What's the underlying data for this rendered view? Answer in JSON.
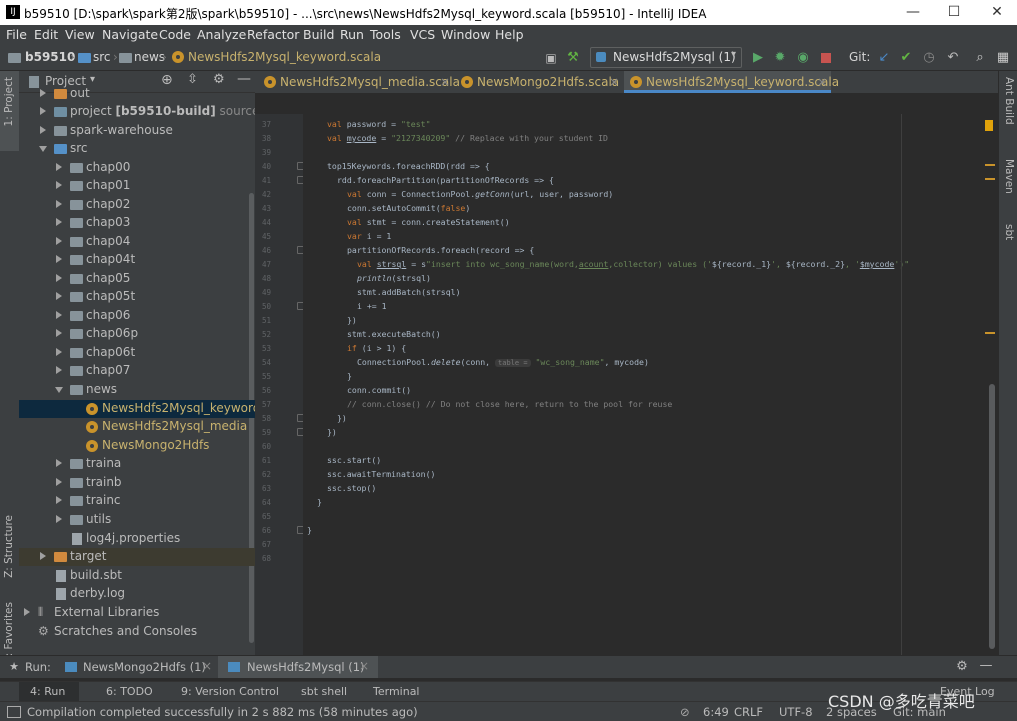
{
  "window": {
    "title": "b59510 [D:\\spark\\spark第2版\\spark\\b59510] - ...\\src\\news\\NewsHdfs2Mysql_keyword.scala [b59510] - IntelliJ IDEA",
    "minimize": "—",
    "maximize": "☐",
    "close": "✕"
  },
  "menu": [
    "File",
    "Edit",
    "View",
    "Navigate",
    "Code",
    "Analyze",
    "Refactor",
    "Build",
    "Run",
    "Tools",
    "VCS",
    "Window",
    "Help"
  ],
  "breadcrumb": [
    "b59510",
    "src",
    "news",
    "NewsHdfs2Mysql_keyword.scala"
  ],
  "toolbar": {
    "run_config": "NewsHdfs2Mysql (1)",
    "git_label": "Git:"
  },
  "left_tabs": {
    "project": "1: Project",
    "structure": "Z: Structure",
    "favorites": "2: Favorites"
  },
  "right_tabs": {
    "ant": "Ant Build",
    "maven": "Maven",
    "sbt": "sbt"
  },
  "project_pane": {
    "title": "Project",
    "items": [
      {
        "label": "out",
        "bold": "",
        "suffix": ""
      },
      {
        "label": "project ",
        "bold": "[b59510-build]",
        "suffix": " sources roo"
      },
      {
        "label": "spark-warehouse",
        "bold": "",
        "suffix": ""
      },
      {
        "label": "src",
        "bold": "",
        "suffix": ""
      },
      {
        "label": "chap00"
      },
      {
        "label": "chap01"
      },
      {
        "label": "chap02"
      },
      {
        "label": "chap03"
      },
      {
        "label": "chap04"
      },
      {
        "label": "chap04t"
      },
      {
        "label": "chap05"
      },
      {
        "label": "chap05t"
      },
      {
        "label": "chap06"
      },
      {
        "label": "chap06p"
      },
      {
        "label": "chap06t"
      },
      {
        "label": "chap07"
      },
      {
        "label": "news"
      },
      {
        "label": "NewsHdfs2Mysql_keyword"
      },
      {
        "label": "NewsHdfs2Mysql_media"
      },
      {
        "label": "NewsMongo2Hdfs"
      },
      {
        "label": "traina"
      },
      {
        "label": "trainb"
      },
      {
        "label": "trainc"
      },
      {
        "label": "utils"
      },
      {
        "label": "log4j.properties"
      },
      {
        "label": "target"
      },
      {
        "label": "build.sbt"
      },
      {
        "label": "derby.log"
      },
      {
        "label": "External Libraries"
      },
      {
        "label": "Scratches and Consoles"
      }
    ]
  },
  "editor_tabs": [
    "NewsHdfs2Mysql_media.scala",
    "NewsMongo2Hdfs.scala",
    "NewsHdfs2Mysql_keyword.scala"
  ],
  "line_numbers": [
    "37",
    "38",
    "39",
    "40",
    "41",
    "42",
    "43",
    "44",
    "45",
    "46",
    "47",
    "48",
    "49",
    "50",
    "51",
    "52",
    "53",
    "54",
    "55",
    "56",
    "57",
    "58",
    "59",
    "60",
    "61",
    "62",
    "63",
    "64",
    "65",
    "66",
    "67",
    "68"
  ],
  "code": {
    "l37": {
      "kw": "val ",
      "a": "password = ",
      "s": "\"test\""
    },
    "l38": {
      "kw": "val ",
      "a": "mycode",
      "b": " = ",
      "s": "\"2127340209\"",
      "c": " // Replace with your student ID"
    },
    "l40": "top15Keywords.foreachRDD(rdd => {",
    "l41": "rdd.foreachPartition(partitionOfRecords => {",
    "l42": {
      "kw": "val ",
      "a": "conn = ConnectionPool.",
      "f": "getConn",
      "b": "(url, user, password)"
    },
    "l43": {
      "a": "conn.setAutoCommit(",
      "kw": "false",
      "b": ")"
    },
    "l44": {
      "kw": "val ",
      "a": "stmt = conn.createStatement()"
    },
    "l45": {
      "kw": "var ",
      "a": "i = 1"
    },
    "l46": "partitionOfRecords.foreach(record => {",
    "l47": {
      "kw": "val ",
      "v": "strsql",
      "a": " = s",
      "s1": "\"insert into wc_song_name(word,",
      "u": "acount",
      "s2": ",collector) values ('",
      "i1": "${record._1}",
      "s3": "', ",
      "i2": "${record._2}",
      "s4": ", '",
      "i3": "$mycode",
      "s5": "')\""
    },
    "l48": {
      "f": "println",
      "a": "(strsql)"
    },
    "l49": "stmt.addBatch(strsql)",
    "l50": "i += 1",
    "l51": "})",
    "l52": "stmt.executeBatch()",
    "l53": {
      "kw": "if ",
      "a": "(i > 1) {"
    },
    "l54": {
      "a": "ConnectionPool.",
      "f": "delete",
      "b": "(conn, ",
      "hint": "table =",
      "s": "\"wc_song_name\"",
      "c": ", mycode)"
    },
    "l55": "}",
    "l56": "conn.commit()",
    "l57": "// conn.close() // Do not close here, return to the pool for reuse",
    "l58": "})",
    "l59": "})",
    "l61": "ssc.start()",
    "l62": "ssc.awaitTermination()",
    "l63": "ssc.stop()",
    "l64": "}",
    "l66": "}"
  },
  "run_bar": {
    "label": "Run:",
    "tabs": [
      "NewsMongo2Hdfs (1)",
      "NewsHdfs2Mysql (1)"
    ]
  },
  "bottom_tools": [
    "4: Run",
    "6: TODO",
    "9: Version Control",
    "sbt shell",
    "Terminal",
    "Event Log"
  ],
  "status": {
    "message": "Compilation completed successfully in 2 s 882 ms (58 minutes ago)",
    "position": "6:49",
    "line_sep": "CRLF",
    "encoding": "UTF-8",
    "indent": "2 spaces",
    "git": "Git: main"
  },
  "watermark": "CSDN @多吃青菜吧"
}
